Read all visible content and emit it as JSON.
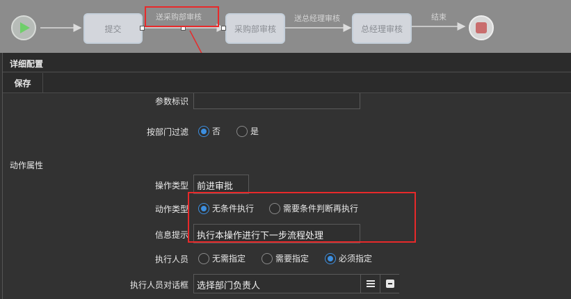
{
  "flow": {
    "nodes": [
      {
        "label": "提交"
      },
      {
        "label": "采购部审核"
      },
      {
        "label": "总经理审核"
      }
    ],
    "edges": [
      {
        "label": "送采购部审核"
      },
      {
        "label": "送总经理审核"
      },
      {
        "label": "结束"
      }
    ]
  },
  "panel": {
    "title": "详细配置",
    "save_label": "保存"
  },
  "form": {
    "param_id": {
      "label": "参数标识",
      "value": ""
    },
    "dept_filter": {
      "label": "按部门过滤",
      "options": [
        {
          "label": "否",
          "selected": true
        },
        {
          "label": "是",
          "selected": false
        }
      ]
    },
    "section_title": "动作属性",
    "op_type": {
      "label": "操作类型",
      "value": "前进审批"
    },
    "action_type": {
      "label": "动作类型",
      "options": [
        {
          "label": "无条件执行",
          "selected": true
        },
        {
          "label": "需要条件判断再执行",
          "selected": false
        }
      ]
    },
    "info_tip": {
      "label": "信息提示",
      "value": "执行本操作进行下一步流程处理"
    },
    "executor": {
      "label": "执行人员",
      "options": [
        {
          "label": "无需指定",
          "selected": false
        },
        {
          "label": "需要指定",
          "selected": false
        },
        {
          "label": "必须指定",
          "selected": true
        }
      ]
    },
    "executor_dialog": {
      "label": "执行人员对话框",
      "value": "选择部门负责人"
    }
  },
  "colors": {
    "accent": "#3d8fe0",
    "highlight": "#e8292a"
  }
}
